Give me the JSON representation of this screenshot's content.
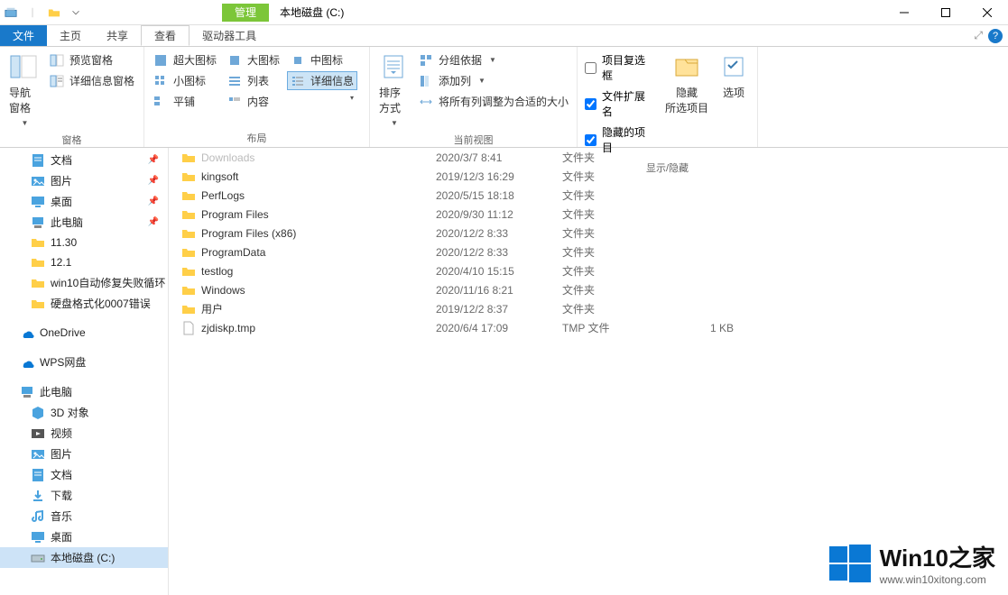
{
  "window": {
    "title": "本地磁盘 (C:)",
    "manage_tab": "管理"
  },
  "tabs": {
    "file": "文件",
    "home": "主页",
    "share": "共享",
    "view": "查看",
    "drive_tools": "驱动器工具"
  },
  "ribbon": {
    "groups": {
      "panes": "窗格",
      "layout": "布局",
      "current_view": "当前视图",
      "show_hide": "显示/隐藏"
    },
    "nav_pane": "导航窗格",
    "preview_pane": "预览窗格",
    "details_pane": "详细信息窗格",
    "extra_large": "超大图标",
    "large_icons": "大图标",
    "medium_icons": "中图标",
    "small_icons": "小图标",
    "list": "列表",
    "details": "详细信息",
    "tiles": "平铺",
    "content": "内容",
    "sort_by": "排序方式",
    "group_by": "分组依据",
    "add_columns": "添加列",
    "autosize": "将所有列调整为合适的大小",
    "item_checkboxes": "项目复选框",
    "file_ext": "文件扩展名",
    "hidden_items": "隐藏的项目",
    "hide_selected": "隐藏\n所选项目",
    "options": "选项"
  },
  "sidebar": {
    "quick_access": [
      {
        "label": "文档",
        "pinned": true,
        "icon": "doc"
      },
      {
        "label": "图片",
        "pinned": true,
        "icon": "pic"
      },
      {
        "label": "桌面",
        "pinned": true,
        "icon": "desktop"
      },
      {
        "label": "此电脑",
        "pinned": true,
        "icon": "pc"
      },
      {
        "label": "11.30",
        "pinned": false,
        "icon": "folder"
      },
      {
        "label": "12.1",
        "pinned": false,
        "icon": "folder"
      },
      {
        "label": "win10自动修复失败循环",
        "pinned": false,
        "icon": "folder"
      },
      {
        "label": "硬盘格式化0007错误",
        "pinned": false,
        "icon": "folder"
      }
    ],
    "onedrive": "OneDrive",
    "wps": "WPS网盘",
    "this_pc": "此电脑",
    "this_pc_children": [
      {
        "label": "3D 对象",
        "icon": "3d"
      },
      {
        "label": "视频",
        "icon": "video"
      },
      {
        "label": "图片",
        "icon": "pic"
      },
      {
        "label": "文档",
        "icon": "doc"
      },
      {
        "label": "下载",
        "icon": "download"
      },
      {
        "label": "音乐",
        "icon": "music"
      },
      {
        "label": "桌面",
        "icon": "desktop"
      },
      {
        "label": "本地磁盘 (C:)",
        "icon": "drive",
        "selected": true
      }
    ]
  },
  "files": [
    {
      "name": "Downloads",
      "date": "2020/3/7 8:41",
      "type": "文件夹",
      "size": "",
      "icon": "folder",
      "cut": true
    },
    {
      "name": "kingsoft",
      "date": "2019/12/3 16:29",
      "type": "文件夹",
      "size": "",
      "icon": "folder"
    },
    {
      "name": "PerfLogs",
      "date": "2020/5/15 18:18",
      "type": "文件夹",
      "size": "",
      "icon": "folder"
    },
    {
      "name": "Program Files",
      "date": "2020/9/30 11:12",
      "type": "文件夹",
      "size": "",
      "icon": "folder"
    },
    {
      "name": "Program Files (x86)",
      "date": "2020/12/2 8:33",
      "type": "文件夹",
      "size": "",
      "icon": "folder"
    },
    {
      "name": "ProgramData",
      "date": "2020/12/2 8:33",
      "type": "文件夹",
      "size": "",
      "icon": "folder"
    },
    {
      "name": "testlog",
      "date": "2020/4/10 15:15",
      "type": "文件夹",
      "size": "",
      "icon": "folder"
    },
    {
      "name": "Windows",
      "date": "2020/11/16 8:21",
      "type": "文件夹",
      "size": "",
      "icon": "folder"
    },
    {
      "name": "用户",
      "date": "2019/12/2 8:37",
      "type": "文件夹",
      "size": "",
      "icon": "folder"
    },
    {
      "name": "zjdiskp.tmp",
      "date": "2020/6/4 17:09",
      "type": "TMP 文件",
      "size": "1 KB",
      "icon": "file"
    }
  ],
  "watermark": {
    "title": "Win10之家",
    "url": "www.win10xitong.com"
  }
}
